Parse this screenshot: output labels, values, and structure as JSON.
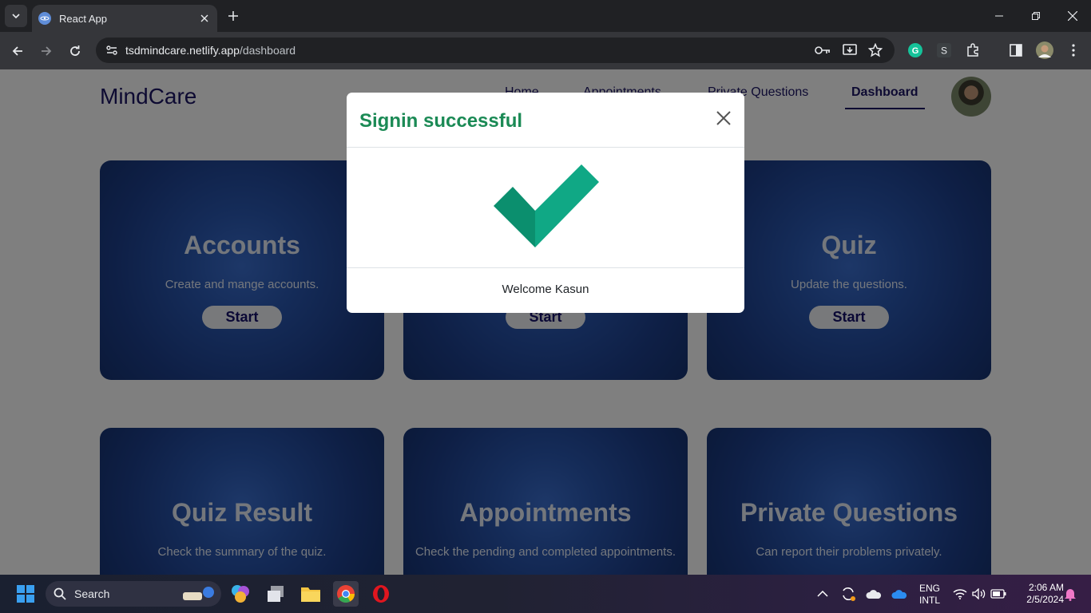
{
  "browser": {
    "tab_title": "React App",
    "url_host": "tsdmindcare.netlify.app",
    "url_path": "/dashboard"
  },
  "app": {
    "brand": "MindCare",
    "nav": [
      {
        "label": "Home"
      },
      {
        "label": "Appointments"
      },
      {
        "label": "Private Questions"
      },
      {
        "label": "Dashboard",
        "active": true
      }
    ]
  },
  "cards": [
    {
      "title": "Accounts",
      "description": "Create and mange accounts.",
      "button": "Start"
    },
    {
      "title": "",
      "description": "",
      "button": "Start"
    },
    {
      "title": "Quiz",
      "description": "Update the questions.",
      "button": "Start"
    },
    {
      "title": "Quiz Result",
      "description": "Check the summary of the quiz."
    },
    {
      "title": "Appointments",
      "description": "Check the pending and completed appointments."
    },
    {
      "title": "Private Questions",
      "description": "Can report their problems privately."
    }
  ],
  "modal": {
    "title": "Signin successful",
    "message": "Welcome Kasun",
    "title_color": "#1b8a55"
  },
  "taskbar": {
    "search_label": "Search",
    "lang_line1": "ENG",
    "lang_line2": "INTL",
    "time": "2:06 AM",
    "date": "2/5/2024"
  }
}
